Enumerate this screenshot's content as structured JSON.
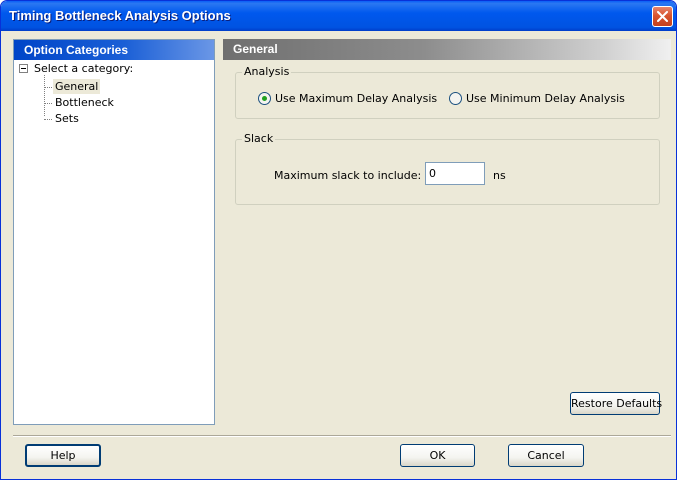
{
  "window": {
    "title": "Timing Bottleneck Analysis Options"
  },
  "categories": {
    "header": "Option Categories",
    "root_label": "Select a category:",
    "items": [
      {
        "label": "General",
        "selected": true
      },
      {
        "label": "Bottleneck",
        "selected": false
      },
      {
        "label": "Sets",
        "selected": false
      }
    ]
  },
  "panel": {
    "header": "General"
  },
  "analysis": {
    "group_title": "Analysis",
    "options": [
      {
        "label": "Use Maximum Delay Analysis",
        "checked": true
      },
      {
        "label": "Use Minimum Delay Analysis",
        "checked": false
      }
    ]
  },
  "slack": {
    "group_title": "Slack",
    "label": "Maximum slack to include:",
    "value": "0",
    "unit": "ns"
  },
  "buttons": {
    "restore_defaults": "Restore Defaults",
    "help": "Help",
    "ok": "OK",
    "cancel": "Cancel"
  },
  "colors": {
    "title_bar": "#0058ee",
    "dialog_background": "#ece9d8",
    "category_header": "#0045c8",
    "panel_header": "#6f6f6f",
    "close_button": "#d8542f",
    "radio_dot": "#21a121"
  },
  "icons": {
    "close": "close-x-icon",
    "tree_expander": "tree-collapse-minus-icon"
  }
}
